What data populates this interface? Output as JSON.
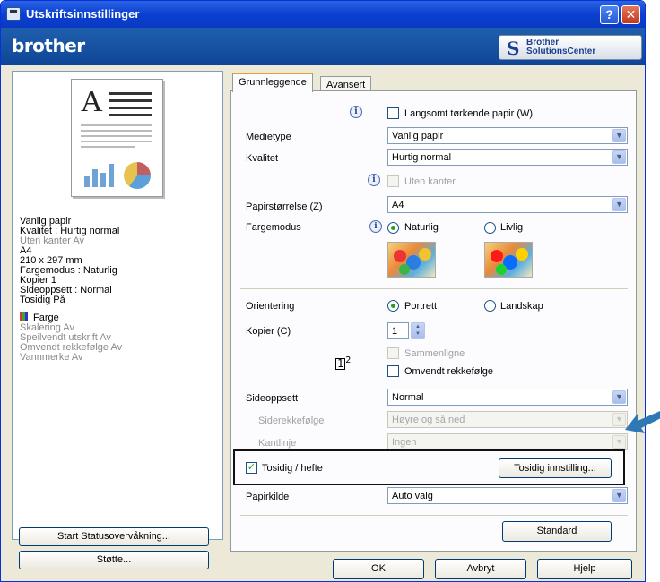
{
  "window": {
    "title": "Utskriftsinnstillinger",
    "help_button": "?",
    "close_button": "✕",
    "brand": "brother",
    "solutions_button": {
      "line1": "Brother",
      "line2": "SolutionsCenter"
    }
  },
  "summary": {
    "lines": [
      {
        "text": "Vanlig papir",
        "dim": false
      },
      {
        "text": "Kvalitet : Hurtig normal",
        "dim": false
      },
      {
        "text": "Uten kanter Av",
        "dim": true
      },
      {
        "text": "A4",
        "dim": false
      },
      {
        "text": "210 x 297 mm",
        "dim": false
      },
      {
        "text": "Fargemodus : Naturlig",
        "dim": false
      },
      {
        "text": "Kopier  1",
        "dim": false
      },
      {
        "text": "Sideoppsett : Normal",
        "dim": false
      },
      {
        "text": "Tosidig På",
        "dim": false
      }
    ],
    "farge": "Farge",
    "lines2": [
      {
        "text": "Skalering Av",
        "dim": true
      },
      {
        "text": "Speilvendt utskrift Av",
        "dim": true
      },
      {
        "text": "Omvendt rekkefølge Av",
        "dim": true
      },
      {
        "text": "Vannmerke Av",
        "dim": true
      }
    ]
  },
  "left_buttons": {
    "status": "Start Statusovervåkning...",
    "support": "Støtte..."
  },
  "tabs": {
    "basic": "Grunnleggende",
    "advanced": "Avansert"
  },
  "basic": {
    "slow_dry": "Langsomt tørkende papir (W)",
    "media_type_label": "Medietype",
    "media_type_value": "Vanlig papir",
    "quality_label": "Kvalitet",
    "quality_value": "Hurtig normal",
    "borderless": "Uten kanter",
    "paper_size_label": "Papirstørrelse (Z)",
    "paper_size_value": "A4",
    "color_mode_label": "Fargemodus",
    "color_natural": "Naturlig",
    "color_vivid": "Livlig",
    "orientation_label": "Orientering",
    "portrait": "Portrett",
    "landscape": "Landskap",
    "copies_label": "Kopier (C)",
    "copies_value": "1",
    "collate": "Sammenligne",
    "reverse_order": "Omvendt rekkefølge",
    "page_layout_label": "Sideoppsett",
    "page_layout_value": "Normal",
    "page_order_label": "Siderekkefølge",
    "page_order_value": "Høyre og så ned",
    "border_line_label": "Kantlinje",
    "border_line_value": "Ingen",
    "duplex": "Tosidig / hefte",
    "duplex_settings": "Tosidig innstilling...",
    "paper_source_label": "Papirkilde",
    "paper_source_value": "Auto valg",
    "default_button": "Standard"
  },
  "footer": {
    "ok": "OK",
    "cancel": "Avbryt",
    "help": "Hjelp"
  },
  "colors": {
    "highlight_border": "#111111",
    "arrow": "#2f78b6",
    "check": "#21a121",
    "titlebar": "#0a3fd0"
  }
}
